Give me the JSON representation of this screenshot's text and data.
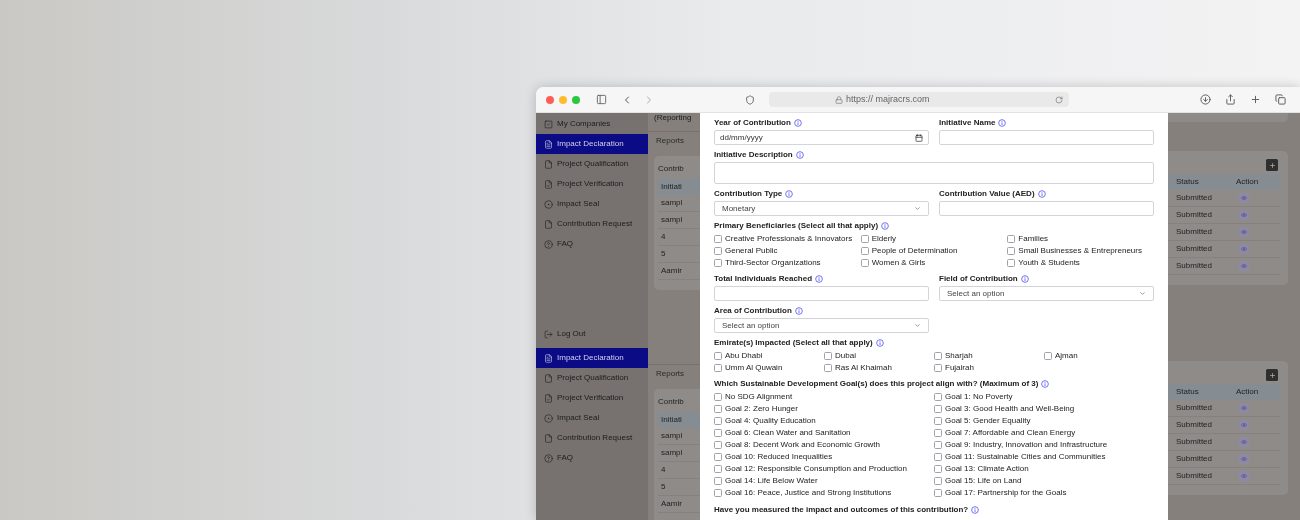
{
  "browser": {
    "url": "https:// majracrs.com"
  },
  "sidebar": {
    "items": [
      {
        "label": "My Companies",
        "selected": false,
        "kind": "companies"
      },
      {
        "label": "Impact Declaration",
        "selected": true,
        "kind": "declaration"
      },
      {
        "label": "Project Qualification",
        "selected": false,
        "kind": "qualification"
      },
      {
        "label": "Project Verification",
        "selected": false,
        "kind": "verification"
      },
      {
        "label": "Impact Seal",
        "selected": false,
        "kind": "seal"
      },
      {
        "label": "Contribution Request",
        "selected": false,
        "kind": "request"
      },
      {
        "label": "FAQ",
        "selected": false,
        "kind": "faq"
      },
      {
        "label": "Log Out",
        "selected": false,
        "kind": "logout"
      },
      {
        "label": "Impact Declaration",
        "selected": true,
        "kind": "declaration"
      },
      {
        "label": "Project Qualification",
        "selected": false,
        "kind": "qualification"
      },
      {
        "label": "Project Verification",
        "selected": false,
        "kind": "verification"
      },
      {
        "label": "Impact Seal",
        "selected": false,
        "kind": "seal"
      },
      {
        "label": "Contribution Request",
        "selected": false,
        "kind": "request"
      },
      {
        "label": "FAQ",
        "selected": false,
        "kind": "faq"
      }
    ]
  },
  "background_page": {
    "sections": [
      {
        "heading": "(Reporting",
        "tab": "Reports",
        "card_title": "Contrib",
        "first_column": "Initiati",
        "status_column": "Status",
        "action_column": "Action",
        "rows": [
          {
            "first": "sampl",
            "status": "Submitted"
          },
          {
            "first": "sampl",
            "status": "Submitted"
          },
          {
            "first": "4",
            "status": "Submitted"
          },
          {
            "first": "5",
            "status": "Submitted"
          },
          {
            "first": "Aamir",
            "status": "Submitted"
          }
        ]
      },
      {
        "tab": "Reports",
        "card_title": "Contrib",
        "first_column": "Initiati",
        "status_column": "Status",
        "action_column": "Action",
        "rows": [
          {
            "first": "sampl",
            "status": "Submitted"
          },
          {
            "first": "sampl",
            "status": "Submitted"
          },
          {
            "first": "4",
            "status": "Submitted"
          },
          {
            "first": "5",
            "status": "Submitted"
          },
          {
            "first": "Aamir",
            "status": "Submitted"
          }
        ]
      }
    ]
  },
  "form": {
    "groups": [
      {
        "kind": "pair",
        "fields": [
          {
            "label": "Year of Contribution",
            "kind": "date",
            "placeholder": "dd/mm/yyyy"
          },
          {
            "label": "Initiative Name",
            "kind": "text"
          }
        ]
      },
      {
        "kind": "single",
        "fields": [
          {
            "label": "Initiative Description",
            "kind": "textarea"
          }
        ]
      },
      {
        "kind": "pair",
        "fields": [
          {
            "label": "Contribution Type",
            "kind": "select",
            "value": "Monetary"
          },
          {
            "label": "Contribution Value (AED)",
            "kind": "text"
          }
        ]
      },
      {
        "kind": "beneficiaries",
        "label": "Primary Beneficiaries (Select all that apply)",
        "options": [
          {
            "label": "Creative Professionals & Innovators",
            "checked": false
          },
          {
            "label": "Elderly",
            "checked": false
          },
          {
            "label": "Families",
            "checked": false
          },
          {
            "label": "General Public",
            "checked": false
          },
          {
            "label": "People of Determination",
            "checked": false
          },
          {
            "label": "Small Businesses & Entrepreneurs",
            "checked": false
          },
          {
            "label": "Third-Sector Organizations",
            "checked": false
          },
          {
            "label": "Women & Girls",
            "checked": false
          },
          {
            "label": "Youth & Students",
            "checked": false
          }
        ]
      },
      {
        "kind": "pair",
        "fields": [
          {
            "label": "Total Individuals Reached",
            "kind": "text"
          },
          {
            "label": "Field of Contribution",
            "kind": "select",
            "value": "Select an option"
          }
        ]
      },
      {
        "kind": "half",
        "fields": [
          {
            "label": "Area of Contribution",
            "kind": "select",
            "value": "Select an option"
          }
        ]
      },
      {
        "kind": "emirates",
        "label": "Emirate(s) Impacted (Select all that apply)",
        "options": [
          {
            "label": "Abu Dhabi",
            "checked": false
          },
          {
            "label": "Dubai",
            "checked": false
          },
          {
            "label": "Sharjah",
            "checked": false
          },
          {
            "label": "Ajman",
            "checked": false
          },
          {
            "label": "Umm Al Quwain",
            "checked": false
          },
          {
            "label": "Ras Al Khaimah",
            "checked": false
          },
          {
            "label": "Fujairah",
            "checked": false
          }
        ]
      },
      {
        "kind": "goals",
        "label": "Which Sustainable Development Goal(s) does this project align with? (Maximum of 3)",
        "options": [
          {
            "label": "No SDG Alignment",
            "checked": false
          },
          {
            "label": "Goal 1: No Poverty",
            "checked": false
          },
          {
            "label": "Goal 2: Zero Hunger",
            "checked": false
          },
          {
            "label": "Goal 3: Good Health and Well-Being",
            "checked": false
          },
          {
            "label": "Goal 4: Quality Education",
            "checked": false
          },
          {
            "label": "Goal 5: Gender Equality",
            "checked": false
          },
          {
            "label": "Goal 6: Clean Water and Sanitation",
            "checked": false
          },
          {
            "label": "Goal 7: Affordable and Clean Energy",
            "checked": false
          },
          {
            "label": "Goal 8: Decent Work and Economic Growth",
            "checked": false
          },
          {
            "label": "Goal 9: Industry, Innovation and Infrastructure",
            "checked": false
          },
          {
            "label": "Goal 10: Reduced Inequalities",
            "checked": false
          },
          {
            "label": "Goal 11: Sustainable Cities and Communities",
            "checked": false
          },
          {
            "label": "Goal 12: Responsible Consumption and Production",
            "checked": false
          },
          {
            "label": "Goal 13: Climate Action",
            "checked": false
          },
          {
            "label": "Goal 14: Life Below Water",
            "checked": false
          },
          {
            "label": "Goal 15: Life on Land",
            "checked": false
          },
          {
            "label": "Goal 16: Peace, Justice and Strong Institutions",
            "checked": false
          },
          {
            "label": "Goal 17: Partnership for the Goals",
            "checked": false
          }
        ]
      },
      {
        "kind": "question",
        "label": "Have you measured the impact and outcomes of this contribution?"
      }
    ]
  }
}
